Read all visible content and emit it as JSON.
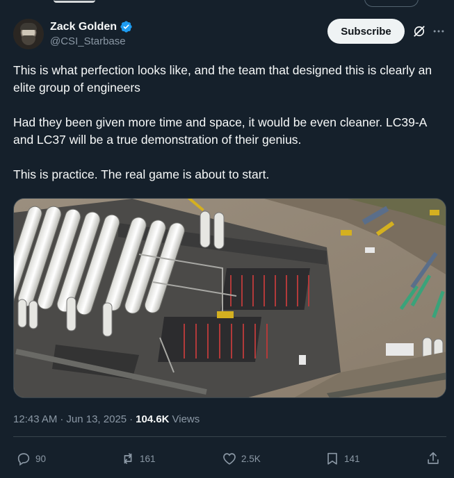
{
  "author": {
    "display_name": "Zack Golden",
    "handle": "@CSI_Starbase",
    "verified": true,
    "verified_color": "#1d9bf0"
  },
  "header": {
    "subscribe_label": "Subscribe",
    "grok_icon": "grok-icon",
    "more_icon": "more-icon"
  },
  "tweet": {
    "paragraphs": [
      "This is what perfection looks like, and the team that designed this is clearly an elite group of engineers",
      "Had they been given more time and space, it would be even cleaner. LC39-A and LC37 will be a true demonstration of their genius.",
      "This is practice.  The real game is about to start."
    ],
    "media": {
      "kind": "photo",
      "icon": "aerial-photo"
    }
  },
  "meta": {
    "time": "12:43 AM",
    "separator": "·",
    "date": "Jun 13, 2025",
    "views_count": "104.6K",
    "views_label": "Views"
  },
  "actions": {
    "replies": "90",
    "reposts": "161",
    "likes": "2.5K",
    "bookmarks": "141"
  },
  "colors": {
    "background": "#15202b",
    "text": "#f7f9f9",
    "secondary": "#8b98a5",
    "border": "#38444d"
  }
}
